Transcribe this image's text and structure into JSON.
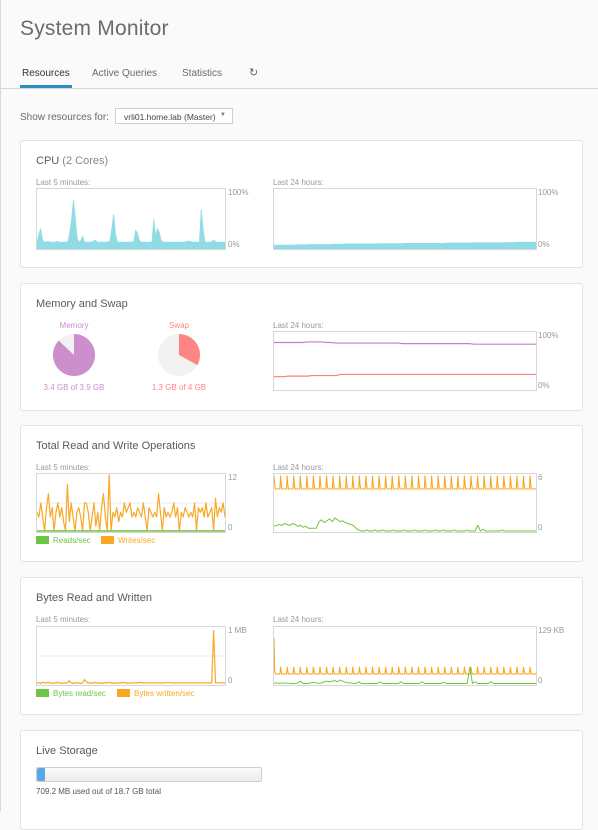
{
  "page": {
    "title": "System Monitor"
  },
  "tabs": [
    {
      "label": "Resources",
      "active": true
    },
    {
      "label": "Active Queries",
      "active": false
    },
    {
      "label": "Statistics",
      "active": false
    }
  ],
  "refresh_icon": "↻",
  "resources": {
    "label": "Show resources for:",
    "selected_host": "vrli01.home.lab (Master)"
  },
  "cpu": {
    "title": "CPU",
    "subtitle": "(2 Cores)",
    "short_label": "Last 5 minutes:",
    "long_label": "Last 24 hours:",
    "y_max_label": "100%",
    "y_min_label": "0%",
    "color": "#8fdce6",
    "short_series": [
      6,
      14,
      20,
      8,
      6,
      6,
      7,
      6,
      6,
      6,
      6,
      7,
      6,
      6,
      6,
      6,
      6,
      7,
      16,
      30,
      50,
      30,
      10,
      6,
      8,
      12,
      6,
      6,
      6,
      6,
      6,
      7,
      8,
      6,
      6,
      6,
      6,
      6,
      6,
      6,
      8,
      20,
      35,
      14,
      6,
      6,
      6,
      6,
      6,
      6,
      6,
      6,
      6,
      6,
      18,
      16,
      8,
      6,
      6,
      6,
      6,
      6,
      6,
      6,
      30,
      12,
      20,
      16,
      8,
      6,
      6,
      6,
      6,
      6,
      6,
      6,
      6,
      6,
      6,
      6,
      6,
      6,
      7,
      7,
      7,
      6,
      6,
      6,
      6,
      6,
      40,
      20,
      6,
      6,
      6,
      6,
      7,
      8,
      6,
      6,
      6,
      6,
      6,
      6
    ],
    "long_series": [
      5,
      5,
      5,
      5,
      5,
      5,
      5,
      5.5,
      5.5,
      5.5,
      5.5,
      6,
      6,
      6,
      6,
      6,
      6,
      6,
      6.5,
      6.5,
      6.5,
      6.5,
      7,
      7,
      7,
      7,
      7,
      7,
      7,
      7,
      7,
      7,
      7.5,
      7.5,
      7.5,
      7.5,
      7.5,
      7.5,
      7.5,
      7.5,
      8,
      8,
      8,
      8,
      8,
      8,
      8,
      8,
      8,
      8,
      8,
      8,
      8,
      8.5,
      8.5,
      8.5,
      8.5,
      8.5,
      8.5,
      8.5,
      8.5,
      9,
      9,
      9,
      9,
      9,
      9,
      9,
      9,
      9,
      9,
      9.5,
      9.5,
      9.5,
      9.5,
      10,
      10,
      10,
      10,
      10,
      10
    ]
  },
  "memory": {
    "title": "Memory and Swap",
    "memory_label": "Memory",
    "memory_text": "3.4 GB of 3.9 GB",
    "memory_fraction": 0.87,
    "memory_color": "#cc8fcc",
    "swap_label": "Swap",
    "swap_text": "1.3 GB of 4 GB",
    "swap_fraction": 0.33,
    "swap_color": "#ff8585",
    "long_label": "Last 24 hours:",
    "y_max_label": "100%",
    "y_min_label": "0%",
    "memory_series": [
      83,
      83,
      83,
      83,
      83,
      83,
      83,
      84,
      84,
      84,
      84,
      83,
      83,
      82,
      82,
      82,
      82,
      82,
      82,
      82,
      82,
      82,
      82,
      82,
      82,
      82,
      82,
      81,
      81,
      81,
      81,
      81,
      81,
      81,
      81,
      81,
      81,
      81,
      81,
      81,
      81,
      81,
      80,
      80,
      80,
      80,
      80,
      80,
      80,
      80,
      80,
      80,
      80,
      80,
      80,
      80
    ],
    "swap_series": [
      22,
      22,
      22,
      23,
      23,
      23,
      23,
      23,
      24,
      24,
      24,
      24,
      24,
      24,
      26,
      26,
      26,
      26,
      26,
      26,
      26,
      26,
      26,
      26,
      26,
      26,
      26,
      26,
      26,
      26,
      26,
      26,
      26,
      26,
      26,
      26,
      26,
      26,
      26,
      26,
      26,
      26,
      26,
      26,
      26,
      26,
      26,
      26,
      26,
      26,
      26,
      26,
      26,
      26,
      26,
      26
    ]
  },
  "ops": {
    "title": "Total Read and Write Operations",
    "short_label": "Last 5 minutes:",
    "long_label": "Last 24 hours:",
    "short_y_max": 12,
    "short_y_max_label": "12",
    "short_y_min_label": "0",
    "long_y_max": 6,
    "long_y_max_label": "6",
    "long_y_min_label": "0",
    "legend": [
      {
        "label": "Reads/sec",
        "color": "#6cc644"
      },
      {
        "label": "Writes/sec",
        "color": "#f9a825"
      }
    ],
    "short_writes": [
      4,
      3,
      6,
      3,
      0,
      5,
      8,
      3,
      5,
      0,
      4,
      6,
      3,
      5,
      2,
      0,
      10,
      2,
      6,
      3,
      0,
      4,
      5,
      3,
      0,
      6,
      6,
      4,
      0,
      3,
      6,
      1,
      4,
      0,
      5,
      8,
      3,
      0,
      12,
      0,
      4,
      3,
      5,
      2,
      4,
      3,
      6,
      4,
      5,
      6,
      3,
      4,
      3,
      5,
      4,
      3,
      6,
      3,
      0,
      5,
      4,
      3,
      4,
      3,
      8,
      4,
      0,
      5,
      3,
      4,
      3,
      4,
      6,
      3,
      5,
      0,
      4,
      3,
      5,
      4,
      3,
      4,
      3,
      6,
      0,
      5,
      4,
      5,
      3,
      6,
      3,
      4,
      5,
      0,
      7,
      3,
      5,
      4,
      6,
      3
    ],
    "short_reads": [
      0,
      0,
      0,
      0,
      0,
      0,
      0,
      0,
      0,
      0,
      0,
      0,
      0,
      0,
      0,
      0,
      0,
      0,
      0,
      0,
      0,
      0,
      0,
      0,
      0,
      0,
      0,
      0,
      0,
      0,
      0,
      0,
      0,
      0,
      0,
      0,
      0,
      0,
      0,
      0,
      0,
      0,
      0,
      0,
      0,
      0,
      0,
      0,
      0,
      0,
      0,
      0,
      0,
      0,
      0,
      0,
      0,
      0,
      0,
      0,
      0,
      0,
      0,
      0,
      0,
      0,
      0,
      0,
      0,
      0,
      0,
      0,
      0,
      0,
      0,
      0,
      0,
      0,
      0,
      0,
      0,
      0,
      0,
      0,
      0,
      0,
      0,
      0,
      0,
      0,
      0,
      0,
      0,
      0,
      0,
      0,
      0,
      0,
      0,
      0
    ],
    "long_writes_base": 4.5,
    "long_writes_peak": 5.9,
    "long_writes_spikes": 40,
    "long_reads": [
      0.5,
      0.6,
      0.7,
      0.6,
      0.8,
      0.7,
      0.6,
      0.8,
      0.7,
      0.5,
      0.6,
      0.4,
      0.5,
      0.3,
      0.3,
      0.3,
      0.3,
      1.0,
      1.2,
      0.9,
      1.1,
      1.3,
      1.0,
      1.4,
      1.2,
      1.0,
      1.1,
      0.9,
      0.8,
      0.7,
      0.6,
      0.3,
      0.1,
      0,
      0,
      0.1,
      0,
      0,
      0.1,
      0,
      0,
      0.1,
      0,
      0,
      0,
      0.1,
      0,
      0,
      0,
      0.1,
      0,
      0,
      0,
      0.1,
      0,
      0,
      0,
      0.1,
      0,
      0,
      0,
      0.1,
      0,
      0,
      0.1,
      0,
      0,
      0,
      0.1,
      0,
      0,
      0,
      0,
      0.1,
      0,
      0,
      0,
      0.6,
      0,
      0.2,
      0,
      0,
      0,
      0,
      0,
      0,
      0.1,
      0,
      0,
      0,
      0,
      0,
      0,
      0,
      0,
      0,
      0,
      0,
      0,
      0
    ]
  },
  "bytes": {
    "title": "Bytes Read and Written",
    "short_label": "Last 5 minutes:",
    "long_label": "Last 24 hours:",
    "short_y_max_label": "1 MB",
    "short_y_min_label": "0",
    "long_y_max_label": "129 KB",
    "long_y_min_label": "0",
    "legend": [
      {
        "label": "Bytes read/sec",
        "color": "#6cc644"
      },
      {
        "label": "Bytes written/sec",
        "color": "#f9a825"
      }
    ],
    "short_writes": [
      0.02,
      0.02,
      0.01,
      0.03,
      0.02,
      0.02,
      0.03,
      0.02,
      0.01,
      0.02,
      0.02,
      0.03,
      0.02,
      0.01,
      0.02,
      0.02,
      0.02,
      0.06,
      0.02,
      0.01,
      0.02,
      0.02,
      0.02,
      0.01,
      0.02,
      0.08,
      0.03,
      0.02,
      0.02,
      0.01,
      0.03,
      0.02,
      0.02,
      0.02,
      0.01,
      0.02,
      0.02,
      0.02,
      0.03,
      0.02,
      0.01,
      0.02,
      0.02,
      0.02,
      0.02,
      0.03,
      0.02,
      0.02,
      0.01,
      0.02,
      0.02,
      0.02,
      0.02,
      0.02,
      0.03,
      0.02,
      0.02,
      0.02,
      0.02,
      0.02,
      0.02,
      0.02,
      0.02,
      0.02,
      0.02,
      0.02,
      0.02,
      0.02,
      0.02,
      0.03,
      0.02,
      0.02,
      0.02,
      0.02,
      0.02,
      0.02,
      0.02,
      0.02,
      0.02,
      0.02,
      0.02,
      0.02,
      0.02,
      0.02,
      0.02,
      0.02,
      0.02,
      0.02,
      0.02,
      0.02,
      0.02,
      0.02,
      0.02,
      0.95,
      0.02,
      0.02,
      0.02,
      0.02,
      0.02,
      0.02
    ],
    "long_writes_base": 0.18,
    "long_writes_peak": 0.3,
    "long_writes_spikes": 40,
    "long_writes_first_peak": 0.82,
    "long_reads": [
      0.01,
      0.02,
      0.01,
      0.02,
      0.01,
      0.02,
      0.01,
      0.01,
      0.01,
      0.02,
      0.05,
      0.01,
      0.01,
      0.01,
      0.02,
      0.03,
      0.02,
      0.01,
      0.02,
      0.04,
      0.05,
      0.04,
      0.05,
      0.06,
      0.04,
      0.07,
      0.05,
      0.03,
      0.02,
      0.02,
      0.01,
      0.01,
      0.04,
      0.01,
      0.01,
      0.01,
      0.01,
      0.01,
      0.01,
      0.01,
      0.04,
      0.01,
      0.01,
      0.01,
      0.01,
      0.01,
      0.01,
      0.01,
      0.04,
      0.01,
      0.01,
      0.01,
      0.01,
      0.01,
      0.01,
      0.01,
      0.04,
      0.01,
      0.01,
      0.01,
      0.01,
      0.01,
      0.01,
      0.01,
      0.03,
      0.01,
      0.01,
      0.01,
      0.01,
      0.01,
      0.01,
      0.01,
      0.01,
      0.01,
      0.3,
      0.01,
      0.04,
      0.01,
      0.01,
      0.01,
      0.01,
      0.01,
      0.04,
      0.01,
      0.01,
      0.01,
      0.01,
      0.01,
      0.01,
      0.01,
      0.01,
      0.01,
      0.01,
      0.01,
      0.01,
      0.01,
      0.01,
      0.01,
      0.01,
      0.01
    ]
  },
  "storage": {
    "title": "Live Storage",
    "used_fraction": 0.037,
    "text": "709.2 MB used out of 18.7 GB total"
  }
}
